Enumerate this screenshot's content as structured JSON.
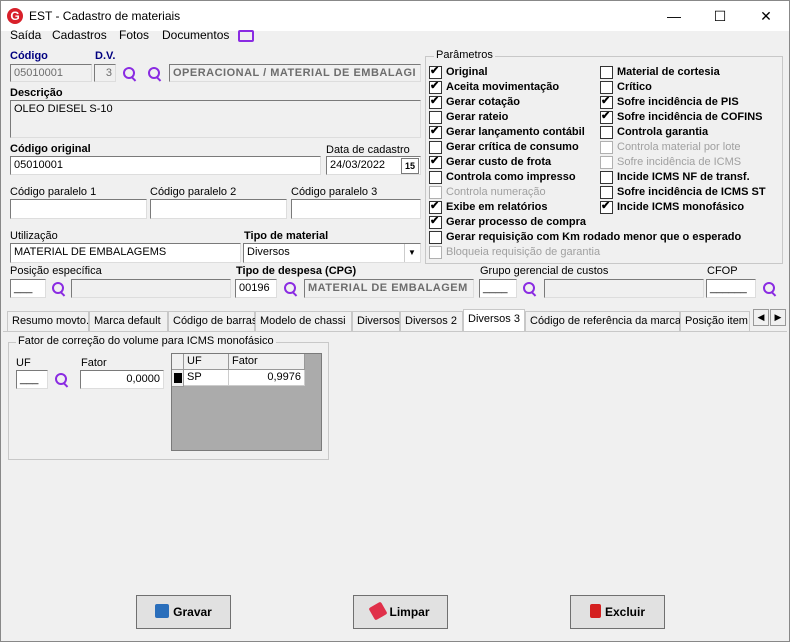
{
  "window": {
    "title": "EST - Cadastro de materiais",
    "app_letter": "G"
  },
  "menu": [
    "Saída",
    "Cadastros",
    "Fotos",
    "Documentos"
  ],
  "fields": {
    "codigo_label": "Código",
    "codigo": "05010001",
    "dv_label": "D.V.",
    "dv": "3",
    "grupo_desc": "OPERACIONAL / MATERIAL DE EMBALAGI",
    "descricao_label": "Descrição",
    "descricao": "OLEO DIESEL S-10",
    "codigo_original_label": "Código original",
    "codigo_original": "05010001",
    "data_cadastro_label": "Data de cadastro",
    "data_cadastro": "24/03/2022",
    "cal_icon": "15",
    "cod_paralelo_1_label": "Código paralelo 1",
    "cod_paralelo_1": "",
    "cod_paralelo_2_label": "Código paralelo 2",
    "cod_paralelo_2": "",
    "cod_paralelo_3_label": "Código paralelo 3",
    "cod_paralelo_3": "",
    "utilizacao_label": "Utilização",
    "utilizacao": "MATERIAL DE EMBALAGEMS",
    "tipo_material_label": "Tipo de material",
    "tipo_material": "Diversos",
    "posicao_label": "Posição específica",
    "posicao": "___",
    "tipo_despesa_label": "Tipo de despesa (CPG)",
    "tipo_despesa_code": "00196",
    "tipo_despesa_desc": "MATERIAL DE EMBALAGEM",
    "grupo_gerencial_label": "Grupo gerencial de custos",
    "grupo_gerencial": "____",
    "cfop_label": "CFOP",
    "cfop": "______"
  },
  "parametros": {
    "title": "Parâmetros",
    "left": [
      {
        "label": "Original",
        "checked": true,
        "enabled": true
      },
      {
        "label": "Aceita movimentação",
        "checked": true,
        "enabled": true
      },
      {
        "label": "Gerar cotação",
        "checked": true,
        "enabled": true
      },
      {
        "label": "Gerar rateio",
        "checked": false,
        "enabled": true
      },
      {
        "label": "Gerar lançamento contábil",
        "checked": true,
        "enabled": true
      },
      {
        "label": "Gerar crítica de consumo",
        "checked": false,
        "enabled": true
      },
      {
        "label": "Gerar custo de frota",
        "checked": true,
        "enabled": true
      },
      {
        "label": "Controla como impresso",
        "checked": false,
        "enabled": true
      },
      {
        "label": "Controla numeração",
        "checked": false,
        "enabled": false
      },
      {
        "label": "Exibe em relatórios",
        "checked": true,
        "enabled": true
      }
    ],
    "right": [
      {
        "label": "Material de cortesia",
        "checked": false,
        "enabled": true
      },
      {
        "label": "Crítico",
        "checked": false,
        "enabled": true
      },
      {
        "label": "Sofre incidência de PIS",
        "checked": true,
        "enabled": true
      },
      {
        "label": "Sofre incidência de COFINS",
        "checked": true,
        "enabled": true
      },
      {
        "label": "Controla garantia",
        "checked": false,
        "enabled": true
      },
      {
        "label": "Controla material por lote",
        "checked": false,
        "enabled": false
      },
      {
        "label": "Sofre incidência de ICMS",
        "checked": false,
        "enabled": false
      },
      {
        "label": "Incide ICMS NF de transf.",
        "checked": false,
        "enabled": true
      },
      {
        "label": "Sofre incidência de ICMS ST",
        "checked": false,
        "enabled": true
      },
      {
        "label": "Incide ICMS monofásico",
        "checked": true,
        "enabled": true
      }
    ],
    "bottom": [
      {
        "label": "Gerar processo de compra",
        "checked": true,
        "enabled": true
      },
      {
        "label": "Gerar requisição com Km rodado menor que o esperado",
        "checked": false,
        "enabled": true
      },
      {
        "label": "Bloqueia requisição de garantia",
        "checked": false,
        "enabled": false
      }
    ]
  },
  "tabs": [
    "Resumo movto.",
    "Marca default",
    "Código de barras",
    "Modelo de chassi",
    "Diversos",
    "Diversos 2",
    "Diversos 3",
    "Código de referência da marca",
    "Posição item"
  ],
  "active_tab": "Diversos 3",
  "icms_group": {
    "title": "Fator de correção do volume para ICMS monofásico",
    "uf_label": "UF",
    "uf": "___",
    "fator_label": "Fator",
    "fator": "0,0000",
    "grid_headers": [
      "UF",
      "Fator"
    ],
    "grid_rows": [
      {
        "uf": "SP",
        "fator": "0,9976"
      }
    ]
  },
  "buttons": {
    "gravar": "Gravar",
    "limpar": "Limpar",
    "excluir": "Excluir"
  },
  "colors": {
    "accent": "#8a2be2",
    "title_label": "#000080",
    "gravar_icon": "#2a6ebb",
    "limpar_icon": "#e0304a",
    "excluir_icon": "#d42020"
  }
}
